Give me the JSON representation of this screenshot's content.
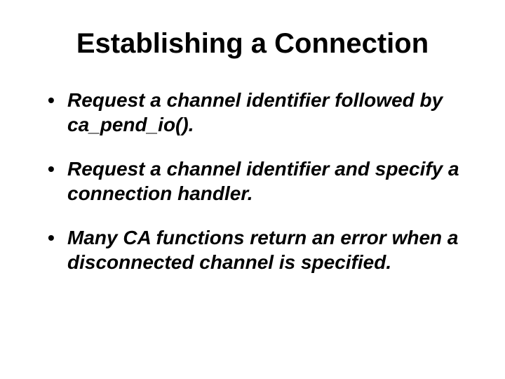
{
  "title": "Establishing a Connection",
  "bullets": [
    "Request a channel identifier followed by ca_pend_io().",
    "Request a channel identifier and specify a connection handler.",
    "Many CA functions return an error when a disconnected channel is specified."
  ]
}
